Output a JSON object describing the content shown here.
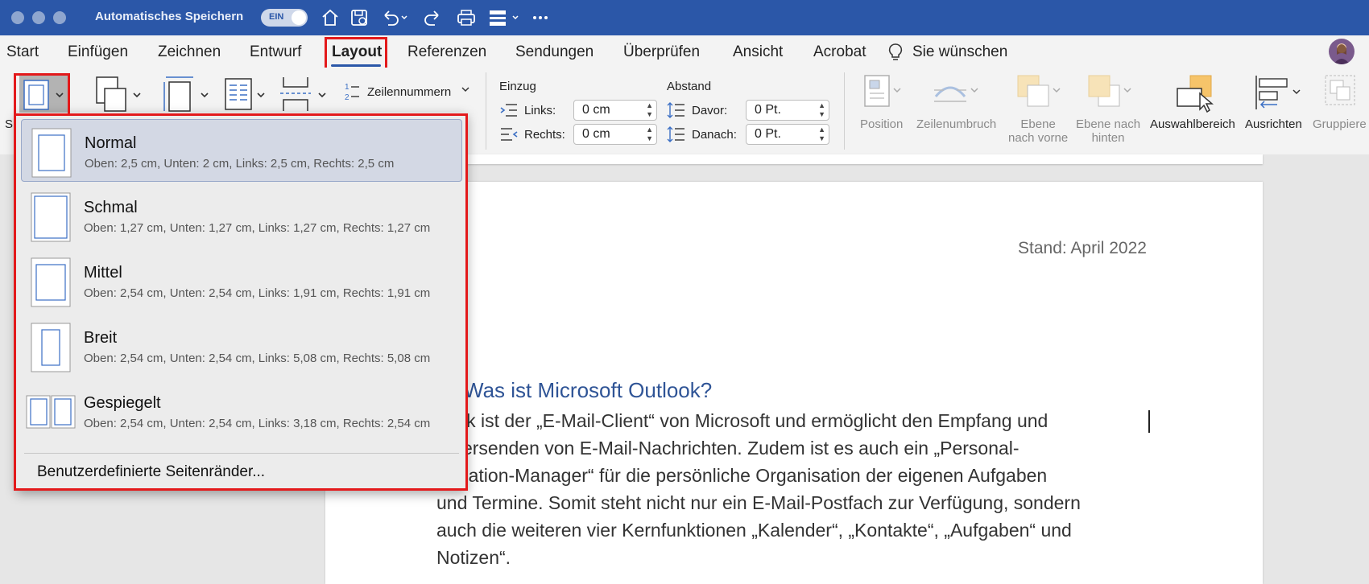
{
  "titlebar": {
    "autosave_label": "Automatisches Speichern",
    "toggle_label": "EIN"
  },
  "menu": {
    "items": [
      "Start",
      "Einfügen",
      "Zeichnen",
      "Entwurf",
      "Layout",
      "Referenzen",
      "Sendungen",
      "Überprüfen",
      "Ansicht",
      "Acrobat"
    ],
    "tell_me": "Sie wünschen"
  },
  "ribbon": {
    "margins_label_partial": "S",
    "zeilennummern": "Zeilennummern",
    "einzug": {
      "title": "Einzug",
      "links_label": "Links:",
      "links_value": "0 cm",
      "rechts_label": "Rechts:",
      "rechts_value": "0 cm"
    },
    "abstand": {
      "title": "Abstand",
      "davor_label": "Davor:",
      "davor_value": "0 Pt.",
      "danach_label": "Danach:",
      "danach_value": "0 Pt."
    },
    "arrange": {
      "position": "Position",
      "zeilenumbruch": "Zeilenumbruch",
      "ebene_vorne_1": "Ebene",
      "ebene_vorne_2": "nach vorne",
      "ebene_hinten_1": "Ebene nach",
      "ebene_hinten_2": "hinten",
      "auswahlbereich": "Auswahlbereich",
      "ausrichten": "Ausrichten",
      "gruppieren": "Gruppiere"
    }
  },
  "dropdown": {
    "items": [
      {
        "title": "Normal",
        "desc": "Oben: 2,5 cm, Unten: 2 cm, Links: 2,5 cm, Rechts: 2,5 cm"
      },
      {
        "title": "Schmal",
        "desc": "Oben: 1,27 cm, Unten: 1,27 cm, Links: 1,27 cm, Rechts: 1,27 cm"
      },
      {
        "title": "Mittel",
        "desc": "Oben: 2,54 cm, Unten: 2,54 cm, Links: 1,91 cm, Rechts: 1,91 cm"
      },
      {
        "title": "Breit",
        "desc": "Oben: 2,54 cm, Unten: 2,54 cm, Links: 5,08 cm, Rechts: 5,08 cm"
      },
      {
        "title": "Gespiegelt",
        "desc": "Oben: 2,54 cm, Unten: 2,54 cm, Links: 3,18 cm, Rechts: 2,54 cm"
      }
    ],
    "custom": "Benutzerdefinierte Seitenränder..."
  },
  "document": {
    "stand": "Stand: April 2022",
    "heading": "Was ist Microsoft Outlook?",
    "lines": [
      "tlook ist der „E-Mail-Client“ von Microsoft und ermöglicht den Empfang und",
      "s Versenden von E-Mail-Nachrichten. Zudem ist es auch ein „Personal-",
      "ormation-Manager“ für die persönliche Organisation der eigenen Aufgaben",
      "und Termine. Somit steht nicht nur ein E-Mail-Postfach zur Verfügung, sondern",
      "auch die weiteren vier Kernfunktionen „Kalender“, „Kontakte“, „Aufgaben“ und",
      "Notizen“."
    ]
  },
  "colors": {
    "titlebar": "#2b57a8",
    "highlight_red": "#e3191b",
    "heading_blue": "#2f5496"
  }
}
